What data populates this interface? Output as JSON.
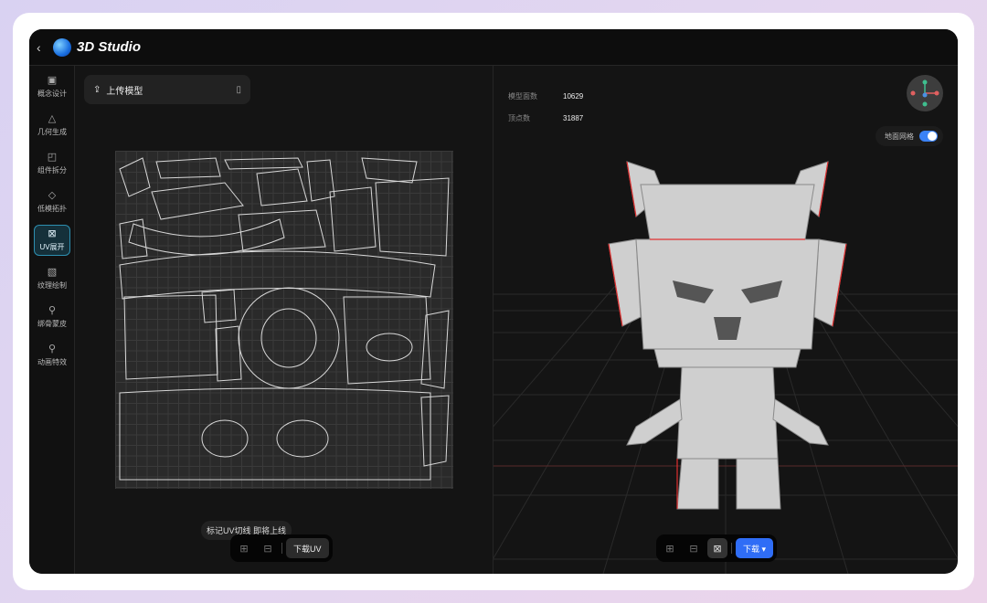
{
  "header": {
    "back": "‹",
    "title": "3D Studio"
  },
  "sidebar": {
    "items": [
      {
        "label": "概念设计",
        "icon": "▣"
      },
      {
        "label": "几何生成",
        "icon": "△"
      },
      {
        "label": "组件拆分",
        "icon": "◰"
      },
      {
        "label": "低模拓扑",
        "icon": "◇"
      },
      {
        "label": "UV展开",
        "icon": "⊠",
        "active": true
      },
      {
        "label": "纹理绘制",
        "icon": "▧"
      },
      {
        "label": "绑骨蒙皮",
        "icon": "⚲"
      },
      {
        "label": "动画特效",
        "icon": "⚲"
      }
    ]
  },
  "left": {
    "upload_label": "上传模型",
    "tooltip": "标记UV切线 即将上线",
    "download_uv": "下载UV"
  },
  "right": {
    "stats": [
      {
        "label": "模型面数",
        "value": "10629"
      },
      {
        "label": "顶点数",
        "value": "31887"
      }
    ],
    "ground_grid_label": "地面网格",
    "ground_grid_on": true,
    "download_label": "下载 ▾"
  },
  "colors": {
    "accent": "#2f6df6",
    "active_nav": "#2d8fb0"
  }
}
